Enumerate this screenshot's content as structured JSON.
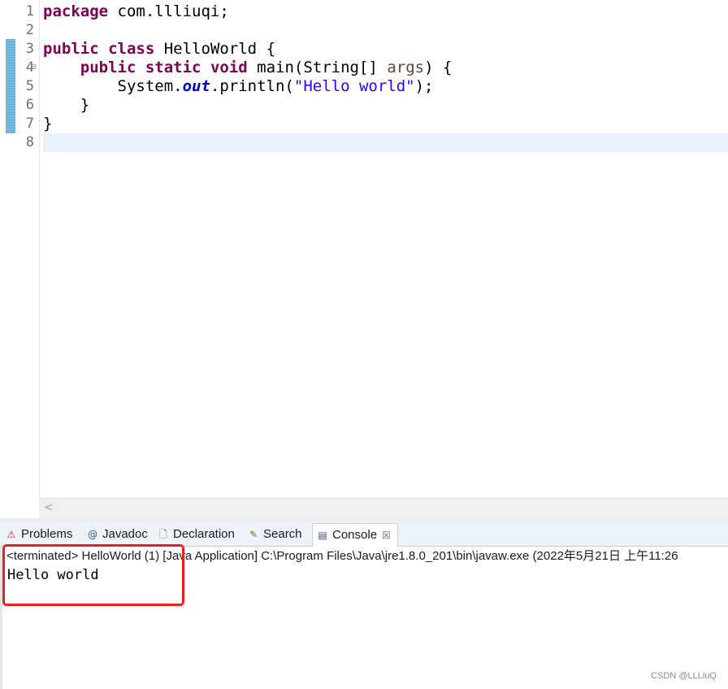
{
  "editor": {
    "line_numbers": [
      "1",
      "2",
      "3",
      "4",
      "5",
      "6",
      "7",
      "8"
    ],
    "lines": [
      [
        {
          "t": "package",
          "c": "kw"
        },
        {
          "t": " com.llliuqi;",
          "c": ""
        }
      ],
      [],
      [
        {
          "t": "public",
          "c": "kw"
        },
        {
          "t": " ",
          "c": ""
        },
        {
          "t": "class",
          "c": "kw"
        },
        {
          "t": " HelloWorld {",
          "c": ""
        }
      ],
      [
        {
          "t": "    ",
          "c": ""
        },
        {
          "t": "public",
          "c": "kw"
        },
        {
          "t": " ",
          "c": ""
        },
        {
          "t": "static",
          "c": "kw"
        },
        {
          "t": " ",
          "c": ""
        },
        {
          "t": "void",
          "c": "kw"
        },
        {
          "t": " main(String[] ",
          "c": ""
        },
        {
          "t": "args",
          "c": "prm"
        },
        {
          "t": ") {",
          "c": ""
        }
      ],
      [
        {
          "t": "        System.",
          "c": ""
        },
        {
          "t": "out",
          "c": "fld"
        },
        {
          "t": ".println(",
          "c": ""
        },
        {
          "t": "\"Hello world\"",
          "c": "str"
        },
        {
          "t": ");",
          "c": ""
        }
      ],
      [
        {
          "t": "    }",
          "c": ""
        }
      ],
      [
        {
          "t": "}",
          "c": ""
        }
      ],
      []
    ],
    "current_line": 8,
    "fold_marker": "⊖"
  },
  "scrollbar": {
    "left_arrow": "<"
  },
  "panel": {
    "tabs": [
      {
        "name": "problems",
        "label": "Problems",
        "icon": "problems-icon",
        "glyph": "⚠"
      },
      {
        "name": "javadoc",
        "label": "Javadoc",
        "icon": "at-icon",
        "glyph": "@"
      },
      {
        "name": "declaration",
        "label": "Declaration",
        "icon": "declaration-icon",
        "glyph": "🗋"
      },
      {
        "name": "search",
        "label": "Search",
        "icon": "flashlight-icon",
        "glyph": "✎"
      },
      {
        "name": "console",
        "label": "Console",
        "icon": "console-icon",
        "glyph": "▤",
        "active": true
      }
    ],
    "close_glyph": "☒",
    "console_header": "<terminated> HelloWorld (1) [Java Application] C:\\Program Files\\Java\\jre1.8.0_201\\bin\\javaw.exe (2022年5月21日 上午11:26",
    "console_output": "Hello world"
  },
  "watermark": "CSDN @LLLiuQ",
  "colors": {
    "keyword": "#7f0055",
    "string": "#2a00ff",
    "field": "#0000c0",
    "highlight_box": "#e8201e"
  }
}
